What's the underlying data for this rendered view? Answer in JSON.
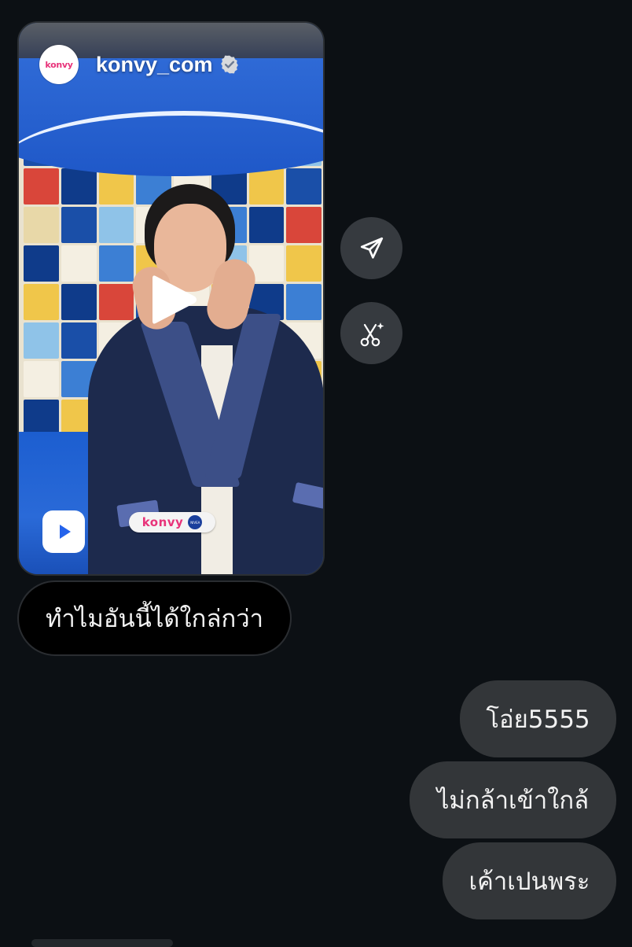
{
  "reel": {
    "username": "konvy_com",
    "avatar_text": "konvy",
    "brand_badge_text": "konvy",
    "brand_badge_secondary": "NIVEA",
    "verified": true
  },
  "icons": {
    "play": "play-icon",
    "reels": "reels-icon",
    "share": "paper-plane-share-icon",
    "ai": "scissors-sparkle-icon",
    "verified": "verified-badge-icon"
  },
  "colors": {
    "background": "#0c1014",
    "sent_bubble": "#333639",
    "received_bubble": "#000000",
    "brand_pink": "#e8337a",
    "side_button": "#363a3f"
  },
  "messages": [
    {
      "direction": "received",
      "text": "ทำไมอันนี้ได้ใกล่กว่า"
    },
    {
      "direction": "sent",
      "text": "โอ่ย5555"
    },
    {
      "direction": "sent",
      "text": "ไม่กล้าเข้าใกล้"
    },
    {
      "direction": "sent",
      "text": "เค้าเปนพระ"
    }
  ]
}
